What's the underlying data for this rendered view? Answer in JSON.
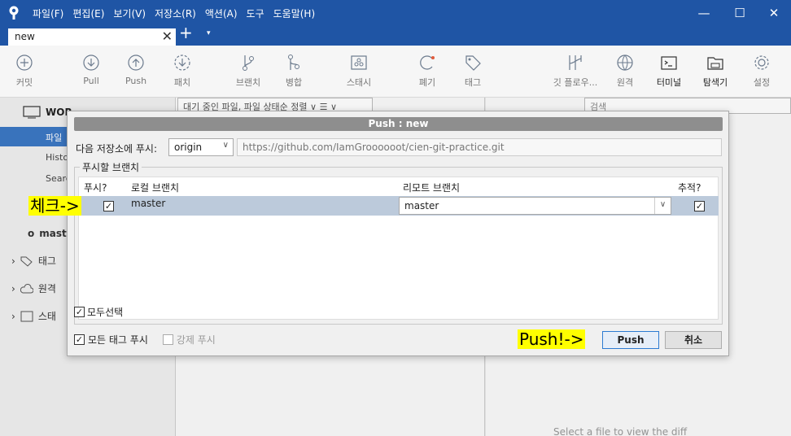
{
  "window": {
    "menu": [
      "파일(F)",
      "편집(E)",
      "보기(V)",
      "저장소(R)",
      "액션(A)",
      "도구",
      "도움말(H)"
    ],
    "controls": {
      "minimize": "—",
      "maximize": "☐",
      "close": "✕"
    }
  },
  "tabs": {
    "active": "new",
    "close": "✕",
    "add": "+",
    "more": "▾"
  },
  "toolbar": {
    "commit": "커밋",
    "pull": "Pull",
    "push": "Push",
    "fetch": "패치",
    "branch": "브랜치",
    "merge": "병합",
    "stash": "스태시",
    "discard": "폐기",
    "tag": "태그",
    "gitflow": "깃 플로우...",
    "remote": "원격",
    "terminal": "터미널",
    "explorer": "탐색기",
    "settings": "설정"
  },
  "sidebar": {
    "workspace": "WOR",
    "items": [
      "파일",
      "Histo",
      "Searc"
    ],
    "branches_label": "o",
    "branch_item": "mast",
    "groups": [
      "태그",
      "원격",
      "스태"
    ]
  },
  "mid": {
    "filter": "대기 중인 파일, 파일 상태순 정렬 ∨  ☰ ∨",
    "search": "검색"
  },
  "right": {
    "hint": "Select a file to view the diff"
  },
  "dialog": {
    "title": "Push : new",
    "remote_label": "다음 저장소에 푸시:",
    "remote_value": "origin",
    "remote_url": "https://github.com/IamGroooooot/cien-git-practice.git",
    "group_label": "푸시할 브랜치",
    "columns": {
      "push": "푸시?",
      "local": "로컬 브랜치",
      "remote": "리모트 브랜치",
      "track": "추적?"
    },
    "rows": [
      {
        "push": true,
        "local": "master",
        "remote": "master",
        "track": true
      }
    ],
    "select_all": "모두선택",
    "push_all_tags": "모든 태그 푸시",
    "force_push": "강제 푸시",
    "push_button": "Push",
    "cancel_button": "취소"
  },
  "annotations": {
    "check": "체크->",
    "push": "Push!->"
  }
}
